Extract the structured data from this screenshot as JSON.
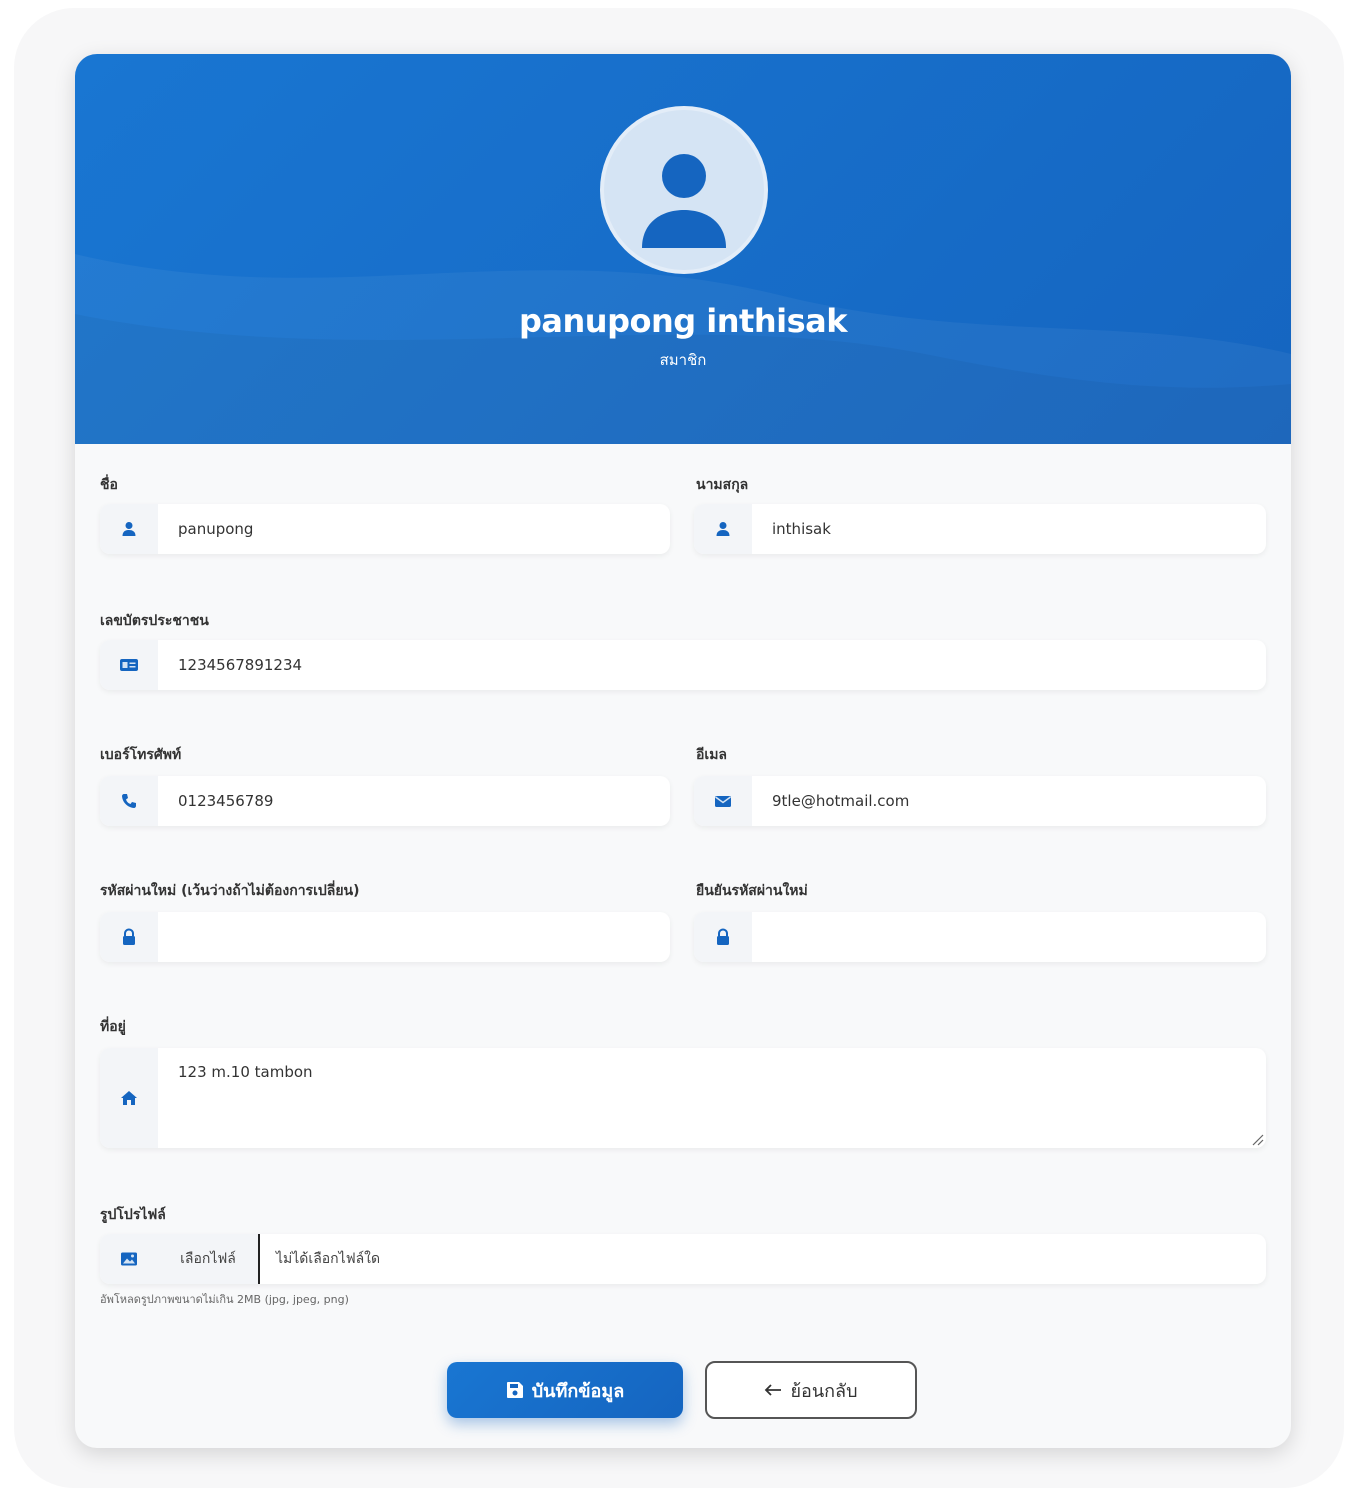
{
  "profile": {
    "display_name": "panupong inthisak",
    "role": "สมาชิก"
  },
  "form": {
    "first_name": {
      "label": "ชื่อ",
      "value": "panupong",
      "icon": "user-icon"
    },
    "last_name": {
      "label": "นามสกุล",
      "value": "inthisak",
      "icon": "user-icon"
    },
    "id_card": {
      "label": "เลขบัตรประชาชน",
      "value": "1234567891234",
      "icon": "id-card-icon"
    },
    "phone": {
      "label": "เบอร์โทรศัพท์",
      "value": "0123456789",
      "icon": "phone-icon"
    },
    "email": {
      "label": "อีเมล",
      "value": "9tle@hotmail.com",
      "icon": "envelope-icon"
    },
    "new_password": {
      "label": "รหัสผ่านใหม่ (เว้นว่างถ้าไม่ต้องการเปลี่ยน)",
      "value": "",
      "icon": "lock-icon"
    },
    "confirm_password": {
      "label": "ยืนยันรหัสผ่านใหม่",
      "value": "",
      "icon": "lock-icon"
    },
    "address": {
      "label": "ที่อยู่",
      "value": "123 m.10 tambon",
      "icon": "home-icon"
    },
    "profile_picture": {
      "label": "รูปโปรไฟล์",
      "choose_button": "เลือกไฟล์",
      "no_file_text": "ไม่ได้เลือกไฟล์ใด",
      "hint": "อัพโหลดรูปภาพขนาดไม่เกิน 2MB (jpg, jpeg, png)",
      "icon": "image-icon"
    }
  },
  "actions": {
    "save_label": "บันทึกข้อมูล",
    "back_label": "ย้อนกลับ"
  },
  "colors": {
    "primary": "#1976d2",
    "primary_dark": "#1565c0",
    "avatar_bg": "#d5e4f4"
  }
}
